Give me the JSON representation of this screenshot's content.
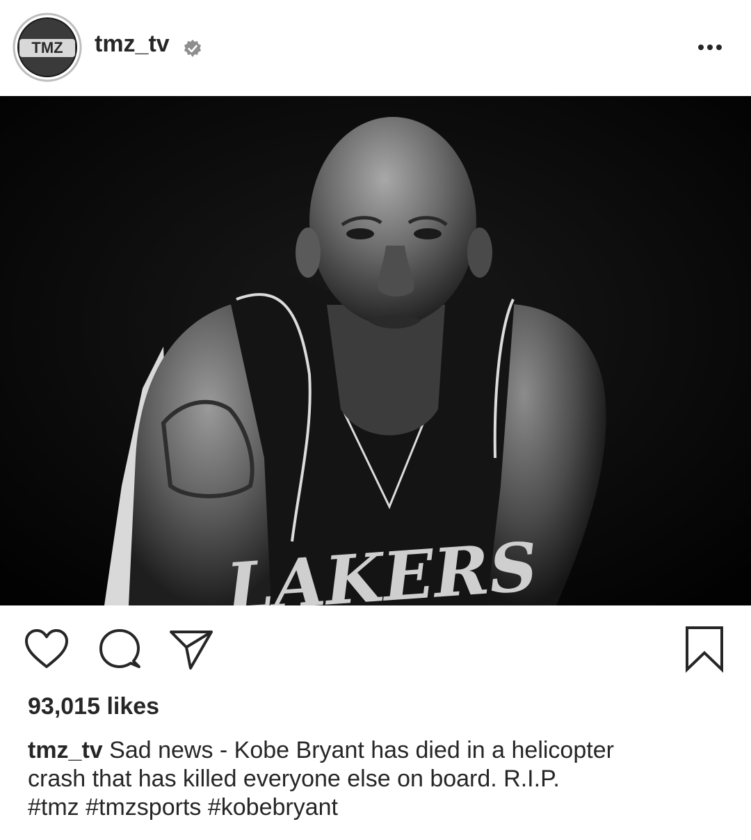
{
  "post": {
    "avatar_text": "TMZ",
    "username": "tmz_tv",
    "verified_icon": "verified-badge-icon",
    "more_icon": "more-options-icon",
    "photo_jersey_text": "LAKERS",
    "actions": {
      "like_icon": "heart-icon",
      "comment_icon": "comment-icon",
      "share_icon": "paper-plane-icon",
      "save_icon": "bookmark-icon"
    },
    "likes": "93,015 likes",
    "caption_user": "tmz_tv",
    "caption_line1": "Sad news - Kobe Bryant has died in a helicopter",
    "caption_line2": "crash that has killed everyone else on board. R.I.P.",
    "caption_line3": "#tmz #tmzsports #kobebryant"
  },
  "colors": {
    "text": "#262626",
    "photo_background": "#050505"
  }
}
